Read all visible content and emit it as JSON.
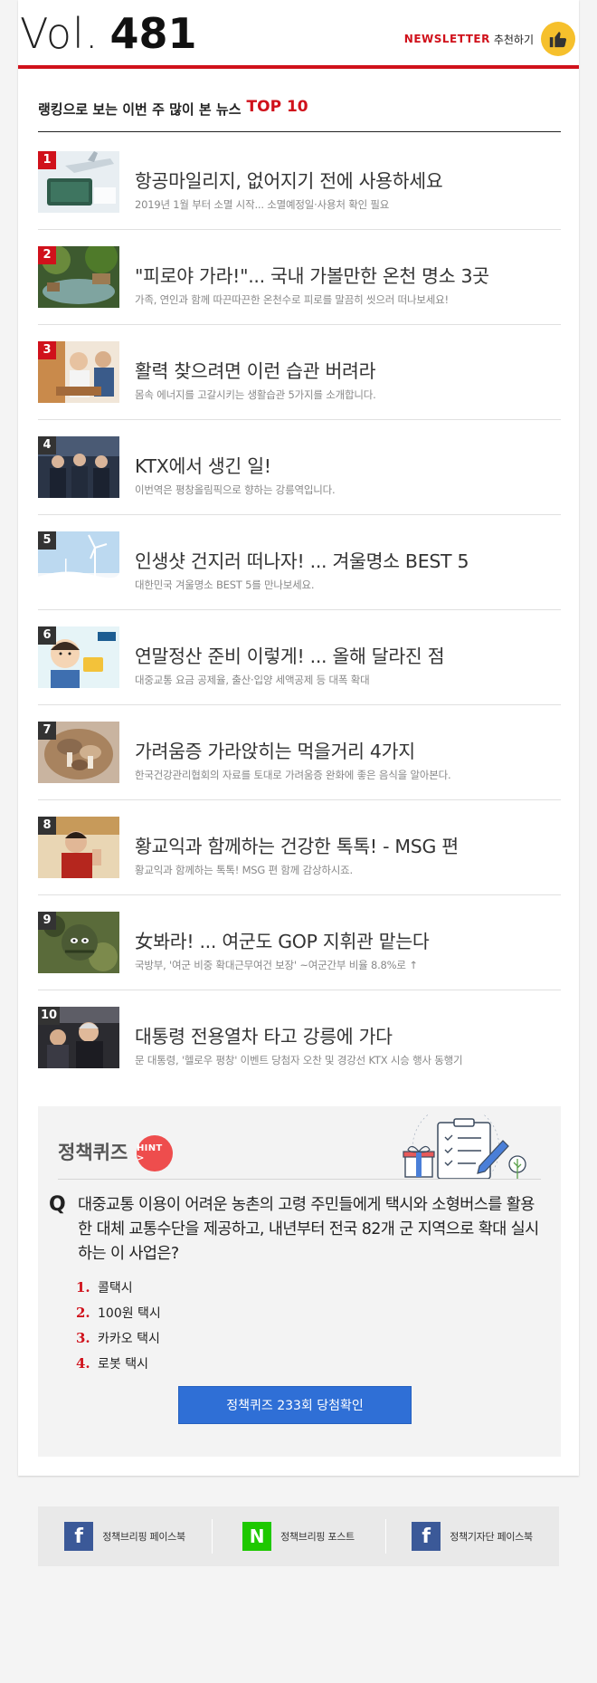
{
  "header": {
    "vol_label": "Vol.",
    "vol_number": "481",
    "recommend_brand": "NEWSLETTER",
    "recommend_label": "추천하기",
    "accent_color": "#d0111b"
  },
  "ranking": {
    "title_prefix": "랭킹으로 보는 이번 주 많이 본 뉴스",
    "title_highlight": "TOP 10",
    "items": [
      {
        "rank": "1",
        "title": "항공마일리지, 없어지기 전에 사용하세요",
        "desc": "2019년 1월 부터 소멸 시작... 소멸예정일·사용처 확인 필요",
        "thumb": "passport-airplane-image"
      },
      {
        "rank": "2",
        "title": "\"피로야 가라!\"... 국내 가볼만한 온천 명소 3곳",
        "desc": "가족, 연인과 함께 따끈따끈한 온천수로 피로를 말끔히 씻으러 떠나보세요!",
        "thumb": "hot-spring-image"
      },
      {
        "rank": "3",
        "title": "활력 찾으려면 이런 습관 버려라",
        "desc": "몸속 에너지를 고갈시키는 생활습관 5가지를 소개합니다.",
        "thumb": "lifestyle-image"
      },
      {
        "rank": "4",
        "title": "KTX에서 생긴 일!",
        "desc": "이번역은 평창올림픽으로 향하는 강릉역입니다.",
        "thumb": "ktx-train-image"
      },
      {
        "rank": "5",
        "title": "인생샷 건지러 떠나자! ... 겨울명소 BEST 5",
        "desc": "대한민국 겨울명소 BEST 5를 만나보세요.",
        "thumb": "winter-windmill-image"
      },
      {
        "rank": "6",
        "title": "연말정산 준비 이렇게! ... 올해 달라진 점",
        "desc": "대중교통 요금 공제율, 출산·입양 세액공제 등 대폭 확대",
        "thumb": "tax-cartoon-image"
      },
      {
        "rank": "7",
        "title": "가려움증 가라앉히는 먹을거리 4가지",
        "desc": "한국건강관리협회의 자료를 토대로 가려움증 완화에 좋은 음식을 알아본다.",
        "thumb": "mushroom-image"
      },
      {
        "rank": "8",
        "title": "황교익과 함께하는 건강한 톡톡! - MSG 편",
        "desc": "황교익과 함께하는 톡톡! MSG 편 함께 감상하시죠.",
        "thumb": "speaker-image"
      },
      {
        "rank": "9",
        "title": "女봐라! ... 여군도 GOP 지휘관 맡는다",
        "desc": "국방부, '여군 비중 확대근무여건 보장' ~여군간부 비율 8.8%로 ↑",
        "thumb": "soldier-image"
      },
      {
        "rank": "10",
        "title": "대통령 전용열차 타고 강릉에 가다",
        "desc": "문 대통령, '헬로우 평창' 이벤트 당첨자 오찬 및 경강선 KTX 시승 행사 동행기",
        "thumb": "president-train-image"
      }
    ]
  },
  "quiz": {
    "title": "정책퀴즈",
    "hint_label": "HINT >",
    "q_mark": "Q",
    "question": "대중교통 이용이 어려운 농촌의 고령 주민들에게 택시와 소형버스를 활용한 대체 교통수단을 제공하고, 내년부터 전국 82개 군 지역으로 확대 실시하는 이 사업은?",
    "options": [
      {
        "num": "1.",
        "text": "콜택시"
      },
      {
        "num": "2.",
        "text": "100원 택시"
      },
      {
        "num": "3.",
        "text": "카카오 택시"
      },
      {
        "num": "4.",
        "text": "로봇 택시"
      }
    ],
    "button_label": "정책퀴즈 233회 당첨확인",
    "button_color": "#2f6fd6"
  },
  "footer": {
    "links": [
      {
        "icon": "facebook-icon",
        "glyph": "f",
        "label": "정책브리핑 페이스북"
      },
      {
        "icon": "naver-post-icon",
        "glyph": "N",
        "label": "정책브리핑 포스트"
      },
      {
        "icon": "facebook-icon",
        "glyph": "f",
        "label": "정책기자단 페이스북"
      }
    ]
  }
}
